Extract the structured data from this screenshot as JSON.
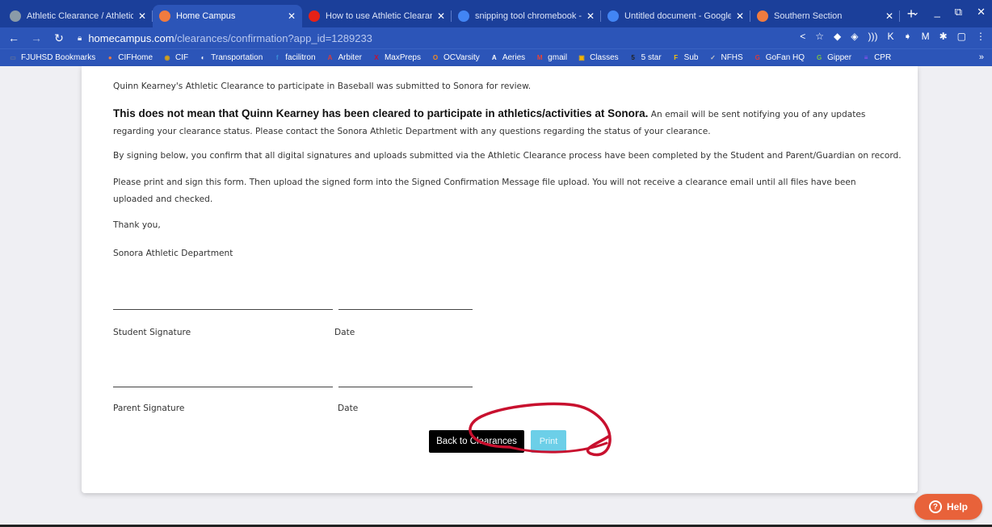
{
  "tabs": [
    {
      "title": "Athletic Clearance / Athletic",
      "icon": "athletic-clearance-favicon",
      "color": "#8a9ba8",
      "active": false
    },
    {
      "title": "Home Campus",
      "icon": "home-campus-favicon",
      "color": "#f07b3f",
      "active": true
    },
    {
      "title": "How to use Athletic Clearanc",
      "icon": "youtube-favicon",
      "color": "#e62117",
      "active": false
    },
    {
      "title": "snipping tool chromebook - (",
      "icon": "google-favicon",
      "color": "#4285f4",
      "active": false
    },
    {
      "title": "Untitled document - Google [",
      "icon": "docs-favicon",
      "color": "#4285f4",
      "active": false
    },
    {
      "title": "Southern Section",
      "icon": "home-campus-favicon",
      "color": "#f07b3f",
      "active": false
    }
  ],
  "toolbar": {
    "url_host": "homecampus.com",
    "url_path": "/clearances/confirmation?app_id=1289233"
  },
  "bookmarks": [
    {
      "label": "FJUHSD Bookmarks",
      "color": "#5a6f9e",
      "glyph": "▭"
    },
    {
      "label": "CIFHome",
      "color": "#f07b3f",
      "glyph": "●"
    },
    {
      "label": "CIF",
      "color": "#d4a017",
      "glyph": "◉"
    },
    {
      "label": "Transportation",
      "color": "#ffffff",
      "glyph": "◐"
    },
    {
      "label": "facilitron",
      "color": "#3b8fd9",
      "glyph": "f"
    },
    {
      "label": "Arbiter",
      "color": "#d93b3b",
      "glyph": "A"
    },
    {
      "label": "MaxPreps",
      "color": "#c8102e",
      "glyph": "X"
    },
    {
      "label": "OCVarsity",
      "color": "#f08a24",
      "glyph": "O"
    },
    {
      "label": "Aeries",
      "color": "#ffffff",
      "glyph": "A"
    },
    {
      "label": "gmail",
      "color": "#ea4335",
      "glyph": "M"
    },
    {
      "label": "Classes",
      "color": "#f4b400",
      "glyph": "▣"
    },
    {
      "label": "5 star",
      "color": "#222222",
      "glyph": "5"
    },
    {
      "label": "Sub",
      "color": "#f4c20d",
      "glyph": "F"
    },
    {
      "label": "NFHS",
      "color": "#c8c8c8",
      "glyph": "✓"
    },
    {
      "label": "GoFan HQ",
      "color": "#d93b3b",
      "glyph": "G"
    },
    {
      "label": "Gipper",
      "color": "#7cc242",
      "glyph": "G"
    },
    {
      "label": "CPR",
      "color": "#a64dff",
      "glyph": "≡"
    }
  ],
  "content": {
    "p1": "Quinn Kearney's Athletic Clearance to participate in Baseball was submitted to Sonora for review.",
    "p2_bold": "This does not mean that Quinn Kearney has been cleared to participate in athletics/activities at Sonora.",
    "p2_rest": " An email will be sent notifying you of any updates regarding your clearance status. Please contact the Sonora Athletic Department with any questions regarding the status of your clearance.",
    "p3": "By signing below, you confirm that all digital signatures and uploads submitted via the Athletic Clearance process have been completed by the Student and Parent/Guardian on record.",
    "p4": "Please print and sign this form. Then upload the signed form into the Signed Confirmation Message file upload. You will not receive a clearance email until all files have been uploaded and checked.",
    "p5": "Thank you,",
    "p6": "Sonora Athletic Department"
  },
  "signatures": {
    "student_label": "Student Signature",
    "parent_label": "Parent Signature",
    "date_label": "Date"
  },
  "buttons": {
    "back_label": "Back to Clearances",
    "print_label": "Print"
  },
  "help": {
    "label": "Help"
  },
  "colors": {
    "chrome_frame": "#1b3f9a",
    "toolbar": "#2c55b8",
    "back_button": "#000000",
    "print_button": "#6ccfe8",
    "help_button": "#e8623a",
    "annotation": "#c8102e"
  }
}
